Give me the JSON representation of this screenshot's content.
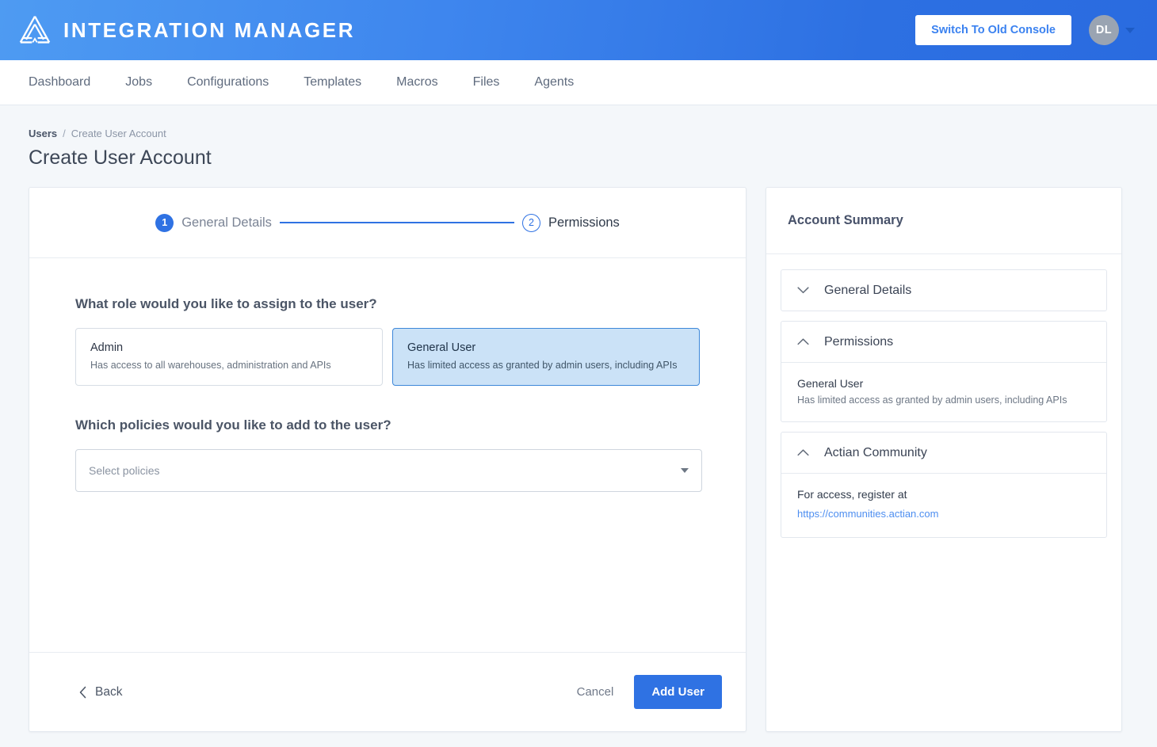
{
  "header": {
    "brand_title": "INTEGRATION MANAGER",
    "logo_icon": "actian-triangle-logo",
    "switch_console_label": "Switch To Old Console",
    "avatar_initials": "DL",
    "avatar_caret_icon": "caret-down-icon",
    "gradient_from": "#4e9bf2",
    "gradient_to": "#2a6be0"
  },
  "nav": {
    "items": [
      {
        "label": "Dashboard"
      },
      {
        "label": "Jobs"
      },
      {
        "label": "Configurations"
      },
      {
        "label": "Templates"
      },
      {
        "label": "Macros"
      },
      {
        "label": "Files"
      },
      {
        "label": "Agents"
      }
    ]
  },
  "breadcrumb": {
    "parent": "Users",
    "separator": "/",
    "current": "Create User Account"
  },
  "page": {
    "title": "Create User Account"
  },
  "stepper": {
    "steps": [
      {
        "number": "1",
        "label": "General Details",
        "state": "completed"
      },
      {
        "number": "2",
        "label": "Permissions",
        "state": "active"
      }
    ],
    "accent_color": "#2f72e3"
  },
  "form": {
    "role_question": "What role would you like to assign to the user?",
    "roles": [
      {
        "name": "Admin",
        "description": "Has access to all warehouses, administration and APIs",
        "selected": false
      },
      {
        "name": "General User",
        "description": "Has limited access as granted by admin users, including APIs",
        "selected": true
      }
    ],
    "policy_question": "Which policies would you like to add to the user?",
    "policy_placeholder": "Select policies",
    "policy_value": "",
    "policy_caret_icon": "caret-down-icon"
  },
  "footer": {
    "back_label": "Back",
    "back_icon": "chevron-left-icon",
    "cancel_label": "Cancel",
    "submit_label": "Add User"
  },
  "summary": {
    "title": "Account Summary",
    "sections": [
      {
        "label": "General Details",
        "icon": "chevron-down-icon",
        "expanded": false
      },
      {
        "label": "Permissions",
        "icon": "chevron-up-icon",
        "expanded": true,
        "role_name": "General User",
        "role_desc": "Has limited access as granted by admin users, including APIs"
      },
      {
        "label": "Actian Community",
        "icon": "chevron-up-icon",
        "expanded": true,
        "text": "For access, register at",
        "link": "https://communities.actian.com"
      }
    ]
  }
}
